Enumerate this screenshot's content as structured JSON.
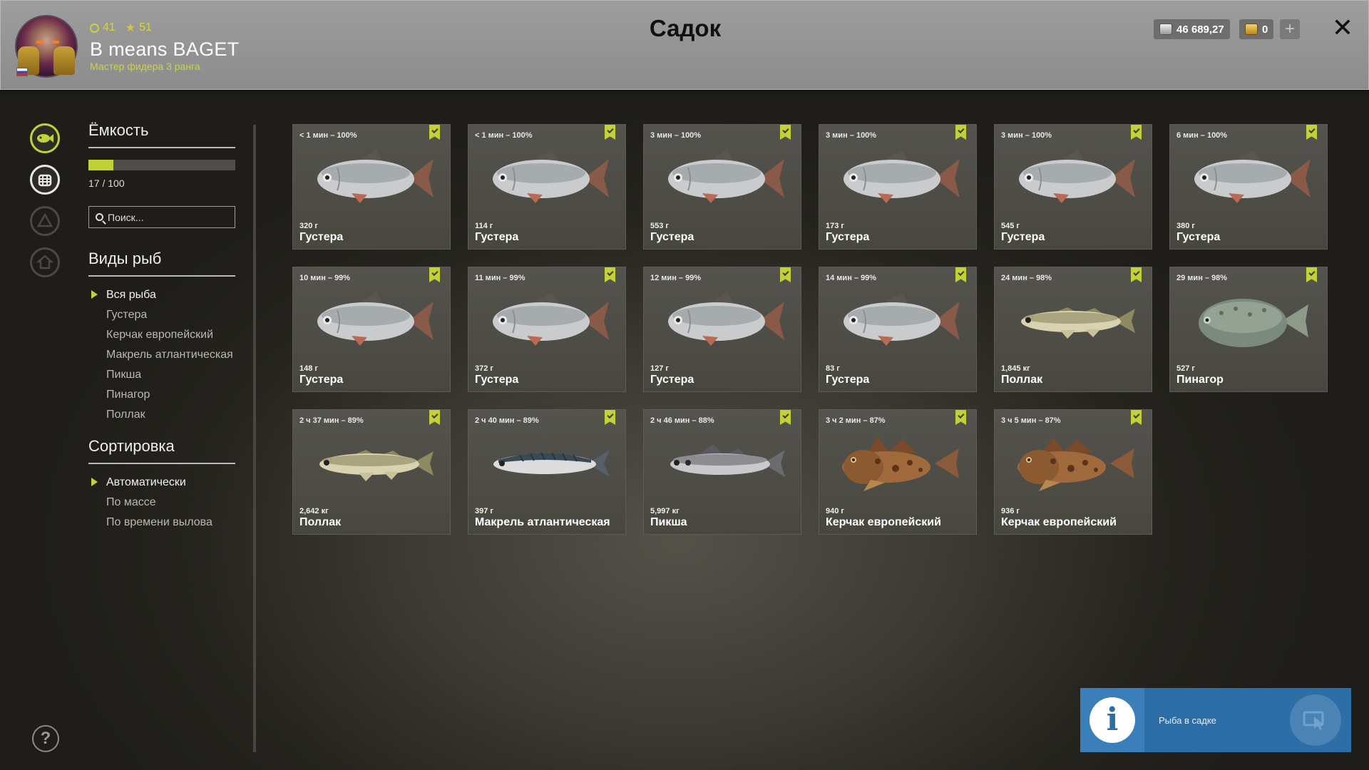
{
  "header": {
    "title": "Садок",
    "player_name": "B means BAGET",
    "player_rank": "Мастер фидера 3 ранга",
    "level": "41",
    "stars": "51",
    "silver_balance": "46 689,27",
    "gold_balance": "0"
  },
  "panel": {
    "capacity_title": "Ёмкость",
    "capacity_text": "17 / 100",
    "capacity_fraction": 0.17,
    "search_placeholder": "Поиск...",
    "species_title": "Виды рыб",
    "species": [
      "Вся рыба",
      "Густера",
      "Керчак европейский",
      "Макрель атлантическая",
      "Пикша",
      "Пинагор",
      "Поллак"
    ],
    "species_selected": 0,
    "sort_title": "Сортировка",
    "sort_options": [
      "Автоматически",
      "По массе",
      "По времени вылова"
    ],
    "sort_selected": 0
  },
  "fish": [
    {
      "time": "< 1 мин – 100%",
      "weight": "320 г",
      "name": "Густера",
      "kind": "bream"
    },
    {
      "time": "< 1 мин – 100%",
      "weight": "114 г",
      "name": "Густера",
      "kind": "bream"
    },
    {
      "time": "3 мин – 100%",
      "weight": "553 г",
      "name": "Густера",
      "kind": "bream"
    },
    {
      "time": "3 мин – 100%",
      "weight": "173 г",
      "name": "Густера",
      "kind": "bream"
    },
    {
      "time": "3 мин – 100%",
      "weight": "545 г",
      "name": "Густера",
      "kind": "bream"
    },
    {
      "time": "6 мин – 100%",
      "weight": "380 г",
      "name": "Густера",
      "kind": "bream"
    },
    {
      "time": "10 мин – 99%",
      "weight": "148 г",
      "name": "Густера",
      "kind": "bream"
    },
    {
      "time": "11 мин – 99%",
      "weight": "372 г",
      "name": "Густера",
      "kind": "bream"
    },
    {
      "time": "12 мин – 99%",
      "weight": "127 г",
      "name": "Густера",
      "kind": "bream"
    },
    {
      "time": "14 мин – 99%",
      "weight": "83 г",
      "name": "Густера",
      "kind": "bream"
    },
    {
      "time": "24 мин – 98%",
      "weight": "1,845 кг",
      "name": "Поллак",
      "kind": "pollock"
    },
    {
      "time": "29 мин – 98%",
      "weight": "527 г",
      "name": "Пинагор",
      "kind": "lumpfish"
    },
    {
      "time": "2 ч 37 мин – 89%",
      "weight": "2,642 кг",
      "name": "Поллак",
      "kind": "pollock"
    },
    {
      "time": "2 ч 40 мин – 89%",
      "weight": "397 г",
      "name": "Макрель атлантическая",
      "kind": "mackerel"
    },
    {
      "time": "2 ч 46 мин – 88%",
      "weight": "5,997 кг",
      "name": "Пикша",
      "kind": "haddock"
    },
    {
      "time": "3 ч 2 мин – 87%",
      "weight": "940 г",
      "name": "Керчак европейский",
      "kind": "sculpin"
    },
    {
      "time": "3 ч 5 мин – 87%",
      "weight": "936 г",
      "name": "Керчак европейский",
      "kind": "sculpin"
    }
  ],
  "notification": {
    "text": "Рыба в садке"
  },
  "colors": {
    "accent": "#c2d236",
    "header_bg": "#959595",
    "notification_bg": "#2c6ea7"
  },
  "icons": [
    "fish-icon",
    "keepnet-icon",
    "trophy-icon",
    "home-icon",
    "help-icon",
    "close-icon",
    "plus-icon",
    "bookmark-icon",
    "info-icon",
    "cursor-icon",
    "search-icon"
  ]
}
